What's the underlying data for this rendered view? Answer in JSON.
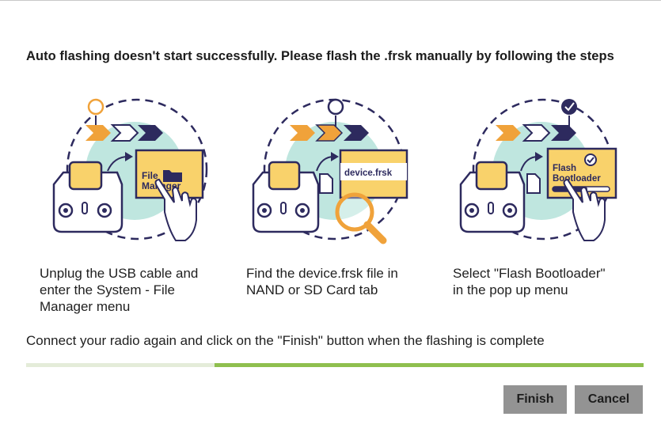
{
  "heading": "Auto flashing doesn't start successfully. Please flash the .frsk manually by following the steps",
  "steps": [
    {
      "caption_lines": [
        "Unplug the USB cable and",
        "enter the System - File",
        "Manager menu"
      ],
      "card_text_lines": [
        "File",
        "Manager"
      ],
      "illustration_icons": [
        "radio-controller-icon",
        "folder-icon",
        "pointing-hand-icon",
        "location-pin-icon"
      ]
    },
    {
      "caption_lines": [
        "Find the device.frsk file in",
        "NAND or SD Card tab"
      ],
      "card_text_lines": [
        "device.frsk"
      ],
      "illustration_icons": [
        "radio-controller-icon",
        "sd-card-icon",
        "magnifier-icon",
        "location-pin-icon"
      ]
    },
    {
      "caption_lines": [
        "Select \"Flash Bootloader\"",
        "in the pop up menu"
      ],
      "card_text_lines": [
        "Flash",
        "Bootloader"
      ],
      "illustration_icons": [
        "radio-controller-icon",
        "sd-card-icon",
        "check-badge-icon",
        "pointing-hand-icon",
        "location-pin-icon"
      ]
    }
  ],
  "instruction": "Connect your radio again and click on the \"Finish\" button when the flashing is complete",
  "progress": {
    "fraction": 0.305,
    "color_filled": "#8fbf4e",
    "color_track": "#e4ecd9"
  },
  "buttons": {
    "finish_label": "Finish",
    "cancel_label": "Cancel"
  },
  "colors": {
    "navy": "#2d2a5e",
    "orange": "#f0a23a",
    "yellow": "#f9d26b",
    "mint": "#bfe6df",
    "button_gray": "#939393"
  }
}
